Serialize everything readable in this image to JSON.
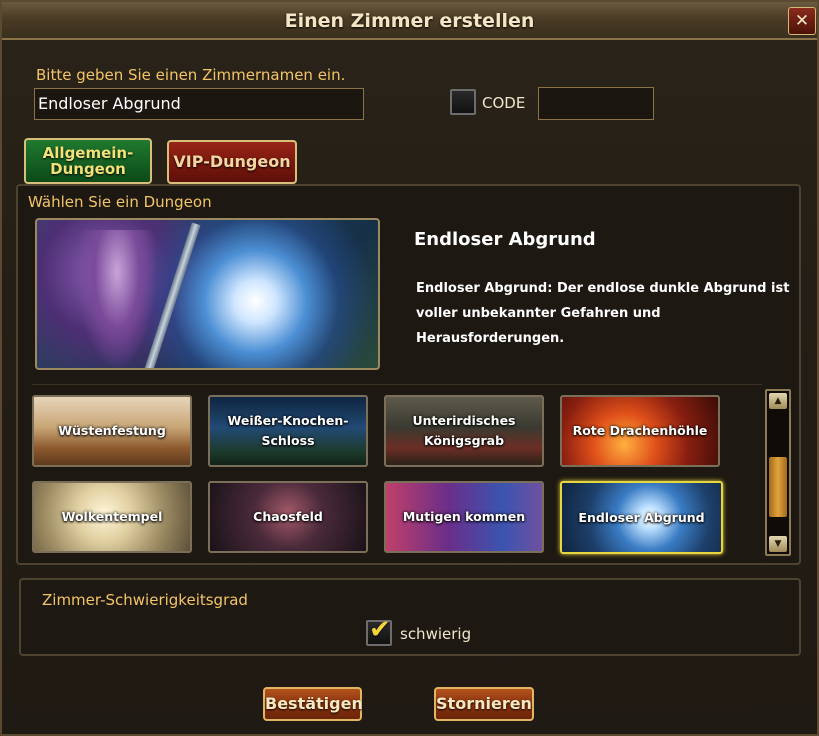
{
  "dialog": {
    "title": "Einen Zimmer erstellen",
    "close_label": "✕"
  },
  "room_name": {
    "label": "Bitte geben Sie einen Zimmernamen ein.",
    "value": "Endloser Abgrund"
  },
  "code": {
    "label": "CODE",
    "checked": false,
    "value": ""
  },
  "tabs": [
    {
      "label": "Allgemein-\nDungeon",
      "active": true,
      "color": "#1f7a2e"
    },
    {
      "label": "VIP-Dungeon",
      "active": false,
      "color": "#9a2418"
    }
  ],
  "dungeon_select": {
    "heading": "Wählen Sie ein Dungeon",
    "selected_title": "Endloser Abgrund",
    "selected_description": "Endloser Abgrund: Der endlose dunkle Abgrund ist voller unbekannter Gefahren und Herausforderungen.",
    "dungeons": [
      {
        "label": "Wüstenfestung",
        "selected": false
      },
      {
        "label": "Weißer-Knochen-Schloss",
        "selected": false
      },
      {
        "label": "Unterirdisches Königsgrab",
        "selected": false
      },
      {
        "label": "Rote Drachenhöhle",
        "selected": false
      },
      {
        "label": "Wolkentempel",
        "selected": false
      },
      {
        "label": "Chaosfeld",
        "selected": false
      },
      {
        "label": "Mutigen kommen",
        "selected": false
      },
      {
        "label": "Endloser Abgrund",
        "selected": true
      }
    ]
  },
  "difficulty": {
    "heading": "Zimmer-Schwierigkeitsgrad",
    "option_label": "schwierig",
    "checked": true
  },
  "buttons": {
    "confirm": "Bestätigen",
    "cancel": "Stornieren"
  },
  "colors": {
    "accent_gold": "#f3c468",
    "selected_border": "#e8d640",
    "button": "#8a3410"
  }
}
